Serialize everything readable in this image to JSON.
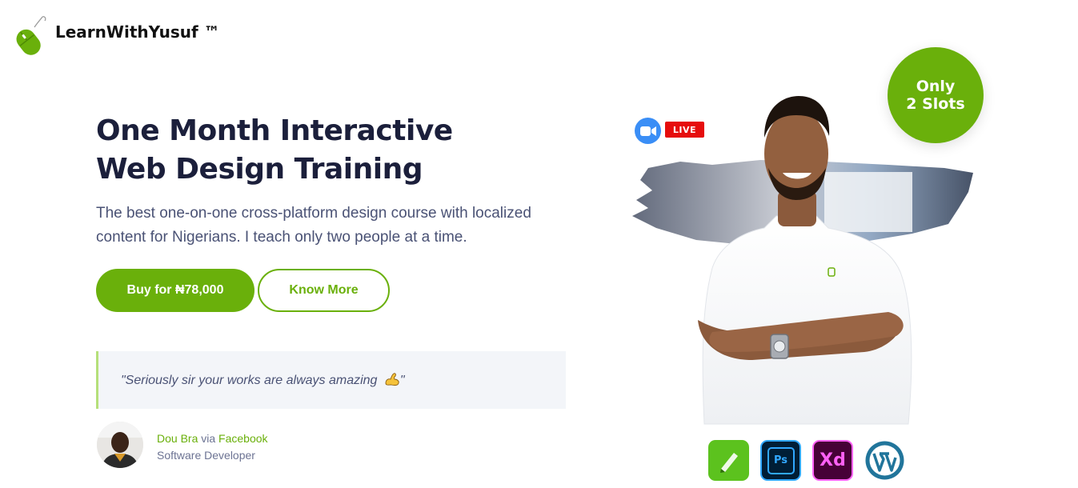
{
  "brand": {
    "name": "LearnWithYusuf ™"
  },
  "hero": {
    "title_line1": "One Month Interactive",
    "title_line2": "Web Design Training",
    "description": "The best one-on-one cross-platform design course with localized content for Nigerians. I teach only two people at a time."
  },
  "buttons": {
    "buy_label": "Buy for ₦78,000",
    "know_more_label": "Know More"
  },
  "testimonial": {
    "quote": "\"Seriously sir your works are always amazing",
    "quote_end": "\"",
    "emoji_icon": "flexed-biceps-icon",
    "author_name": "Dou Bra",
    "via": "via",
    "platform": "Facebook",
    "role": "Software Developer"
  },
  "badges": {
    "live": "LIVE",
    "slots_line1": "Only",
    "slots_line2": "2 Slots",
    "video_icon": "zoom-video-icon"
  },
  "tools": [
    {
      "name": "sketch-pen-icon",
      "color": "#5cc21e"
    },
    {
      "name": "photoshop-icon",
      "label": "Ps",
      "color": "#001e36"
    },
    {
      "name": "adobe-xd-icon",
      "label": "Xd",
      "color": "#470137"
    },
    {
      "name": "wordpress-icon",
      "color": "#21759b"
    }
  ],
  "colors": {
    "accent": "#6ab00b",
    "live": "#e60d0d",
    "zoom": "#3a8ef6"
  }
}
